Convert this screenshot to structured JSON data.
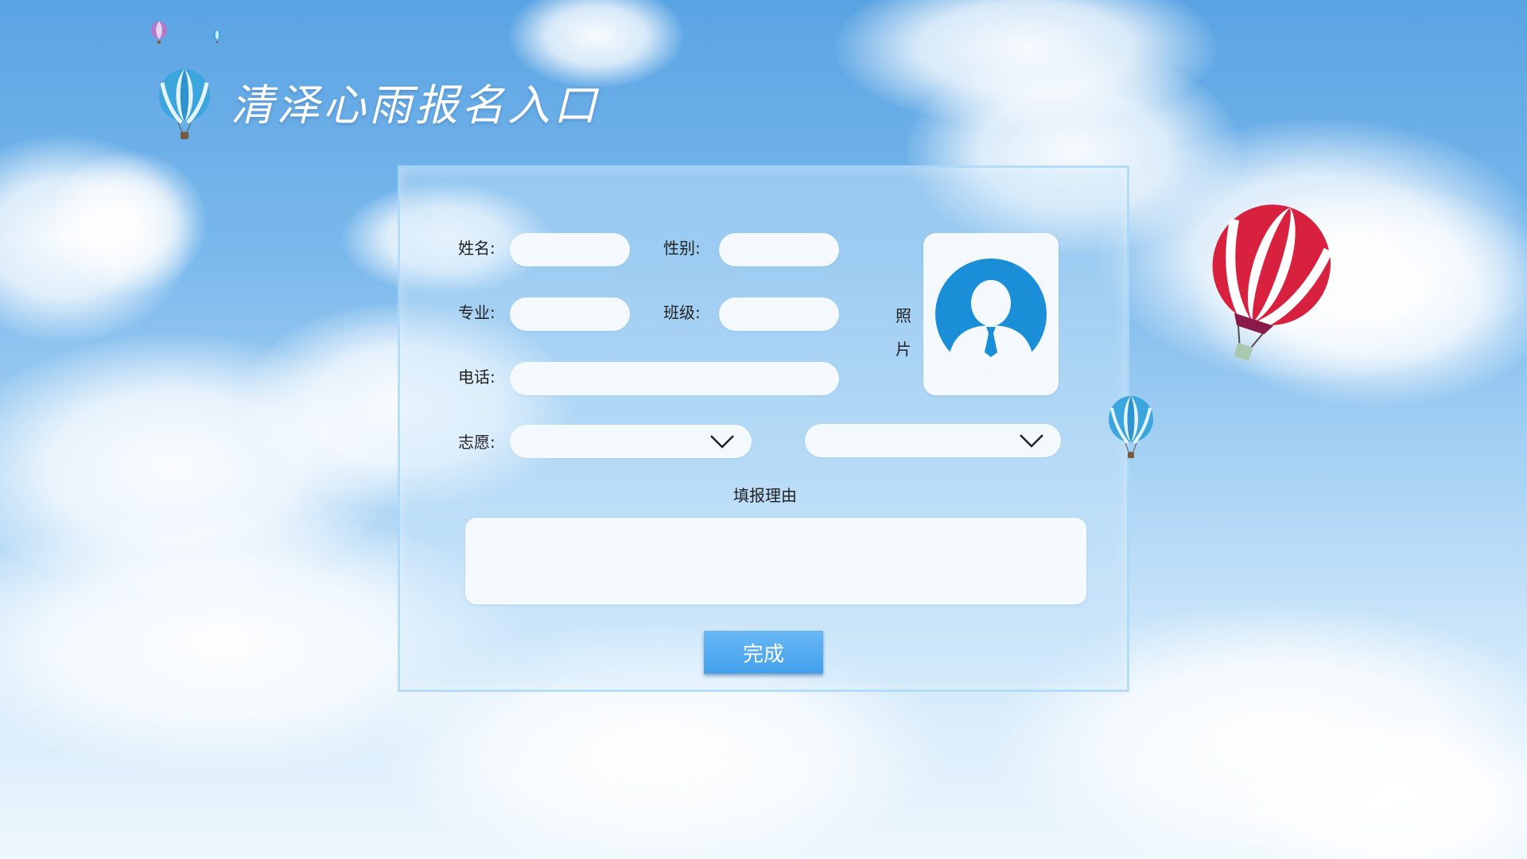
{
  "header": {
    "title": "清泽心雨报名入口"
  },
  "form": {
    "name_label": "姓名:",
    "name_value": "",
    "gender_label": "性别:",
    "gender_value": "",
    "major_label": "专业:",
    "major_value": "",
    "class_label": "班级:",
    "class_value": "",
    "phone_label": "电话:",
    "phone_value": "",
    "wish_label": "志愿:",
    "wish1_selected": "",
    "wish2_selected": "",
    "photo_label_1": "照",
    "photo_label_2": "片",
    "reason_title": "填报理由",
    "reason_value": "",
    "submit_label": "完成"
  },
  "icons": {
    "photo_placeholder": "person-avatar-icon",
    "select_arrow": "chevron-down-icon",
    "decor": "hot-air-balloon-icon"
  },
  "colors": {
    "accent": "#43a0ec",
    "avatar": "#1a8fd8",
    "balloon_red": "#d8203f",
    "balloon_blue": "#3aa6dd"
  }
}
